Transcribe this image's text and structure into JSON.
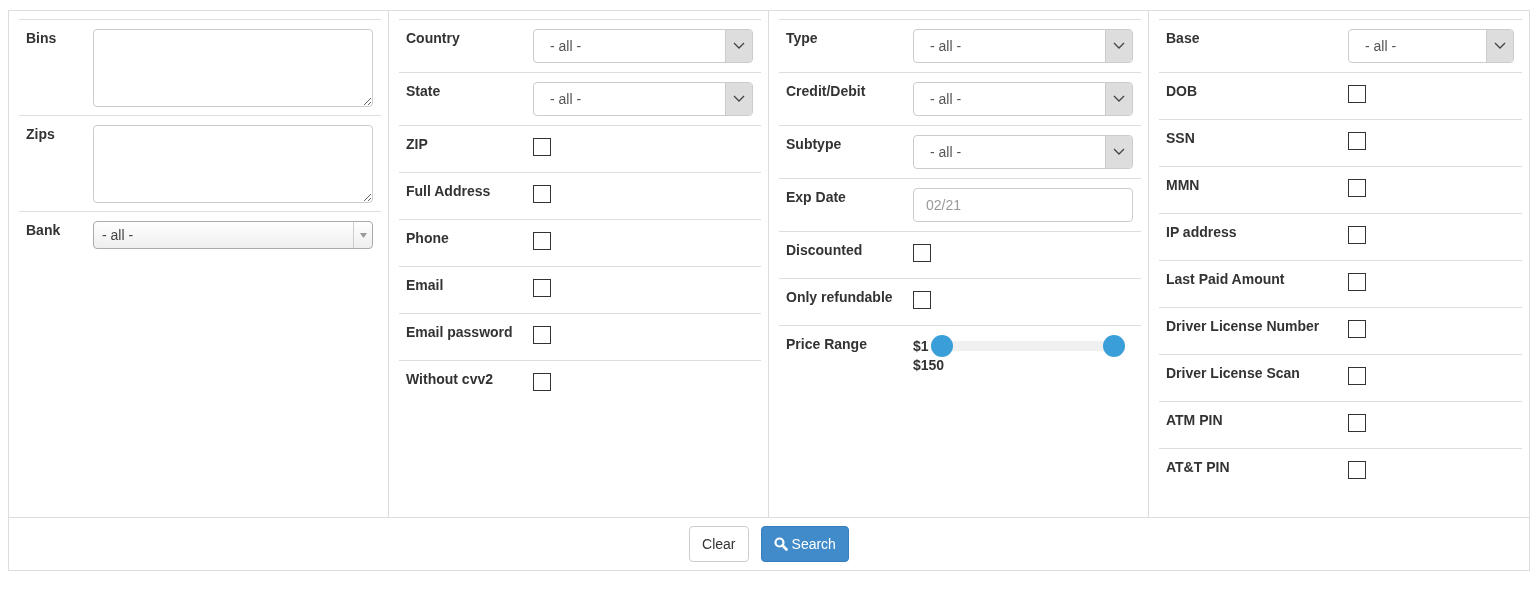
{
  "columns": [
    {
      "rows": [
        {
          "kind": "textarea",
          "label": "Bins"
        },
        {
          "kind": "textarea",
          "label": "Zips"
        },
        {
          "kind": "combo",
          "label": "Bank",
          "value": "- all -"
        }
      ]
    },
    {
      "rows": [
        {
          "kind": "select",
          "label": "Country",
          "value": "- all -"
        },
        {
          "kind": "select",
          "label": "State",
          "value": "- all -"
        },
        {
          "kind": "checkbox",
          "label": "ZIP",
          "checked": false
        },
        {
          "kind": "checkbox",
          "label": "Full Address",
          "checked": false
        },
        {
          "kind": "checkbox",
          "label": "Phone",
          "checked": false
        },
        {
          "kind": "checkbox",
          "label": "Email",
          "checked": false
        },
        {
          "kind": "checkbox",
          "label": "Email password",
          "checked": false
        },
        {
          "kind": "checkbox",
          "label": "Without cvv2",
          "checked": false
        }
      ]
    },
    {
      "rows": [
        {
          "kind": "select",
          "label": "Type",
          "value": "- all -"
        },
        {
          "kind": "select",
          "label": "Credit/Debit",
          "value": "- all -"
        },
        {
          "kind": "select",
          "label": "Subtype",
          "value": "- all -"
        },
        {
          "kind": "text",
          "label": "Exp Date",
          "placeholder": "02/21"
        },
        {
          "kind": "checkbox",
          "label": "Discounted",
          "checked": false
        },
        {
          "kind": "checkbox",
          "label": "Only refundable",
          "checked": false
        },
        {
          "kind": "range",
          "label": "Price Range",
          "min_text": "$1",
          "max_text": "$150",
          "thumbs": [
            {
              "level": 0
            },
            {
              "level": 1
            }
          ]
        }
      ]
    },
    {
      "rows": [
        {
          "kind": "select",
          "label": "Base",
          "value": "- all -"
        },
        {
          "kind": "checkbox",
          "label": "DOB",
          "checked": false
        },
        {
          "kind": "checkbox",
          "label": "SSN",
          "checked": false
        },
        {
          "kind": "checkbox",
          "label": "MMN",
          "checked": false
        },
        {
          "kind": "checkbox",
          "label": "IP address",
          "checked": false
        },
        {
          "kind": "checkbox",
          "label": "Last Paid Amount",
          "checked": false
        },
        {
          "kind": "checkbox",
          "label": "Driver License Number",
          "checked": false
        },
        {
          "kind": "checkbox",
          "label": "Driver License Scan",
          "checked": false
        },
        {
          "kind": "checkbox",
          "label": "ATM PIN",
          "checked": false
        },
        {
          "kind": "checkbox",
          "label": "AT&T PIN",
          "checked": false
        }
      ]
    }
  ],
  "buttons": [
    {
      "kind": "default",
      "label": "Clear"
    },
    {
      "kind": "primary",
      "label": "Search"
    }
  ]
}
